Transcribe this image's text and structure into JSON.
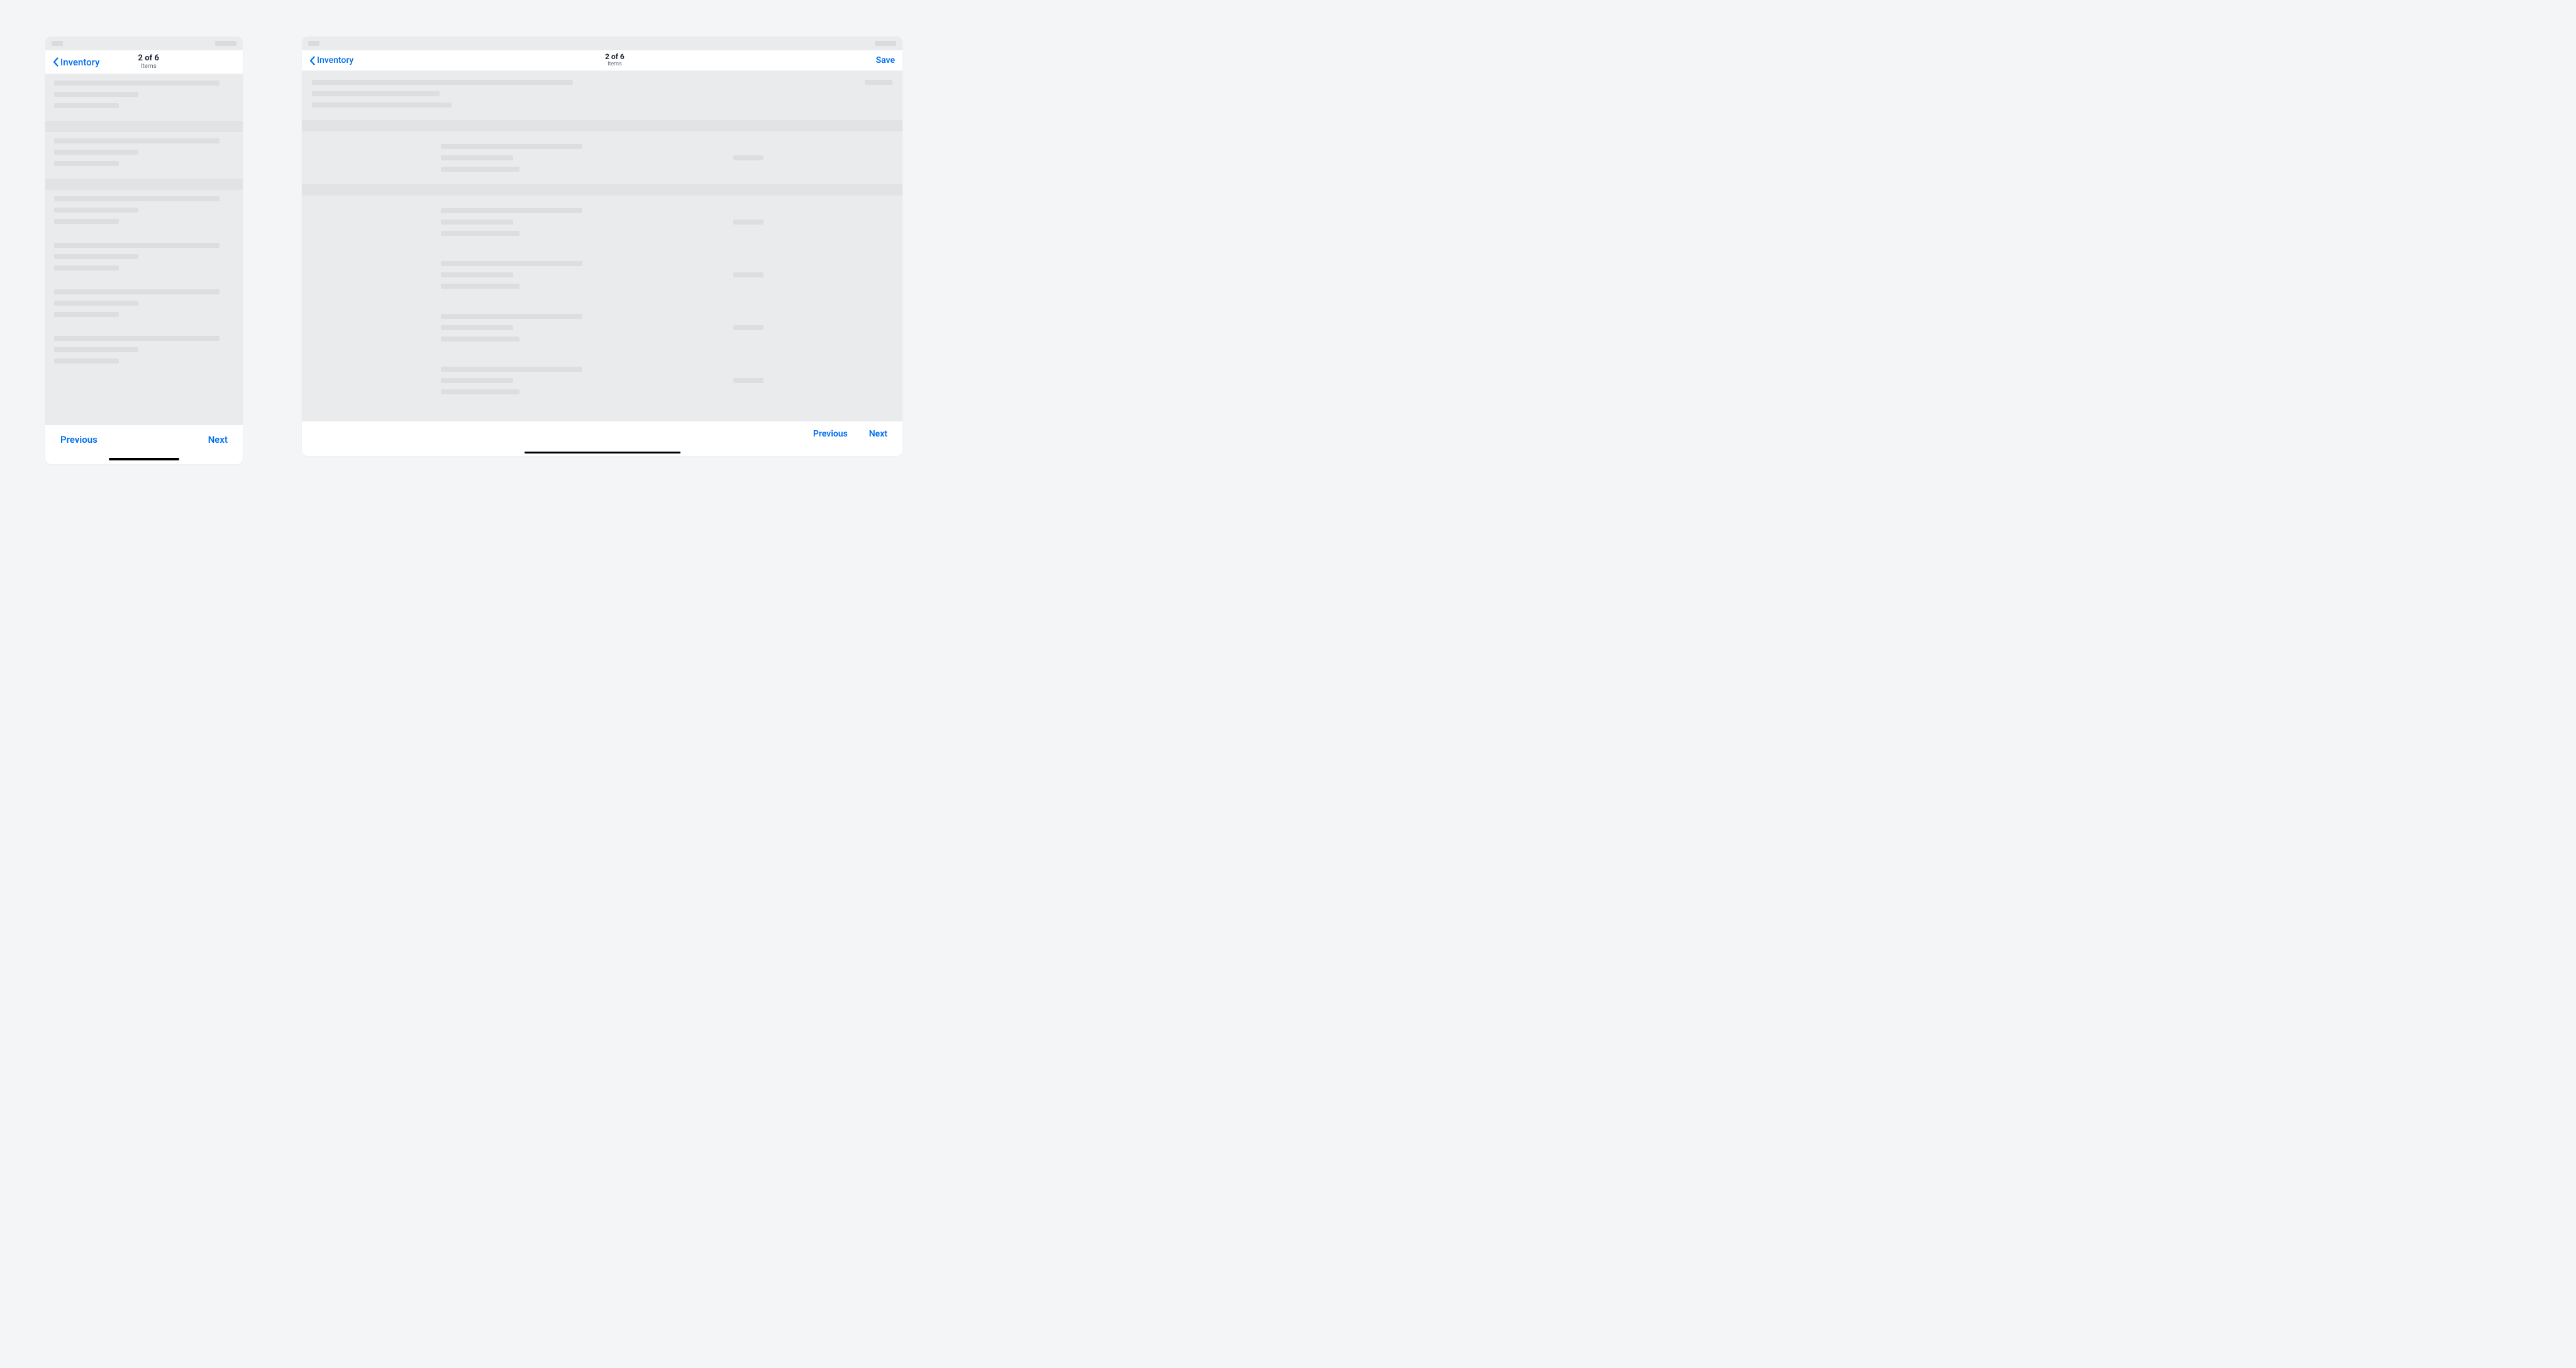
{
  "phone": {
    "nav": {
      "back_label": "Inventory",
      "title": "2 of 6",
      "subtitle": "Items"
    },
    "bottom": {
      "prev": "Previous",
      "next": "Next"
    }
  },
  "tablet": {
    "nav": {
      "back_label": "Inventory",
      "title": "2 of 6",
      "subtitle": "Items",
      "save": "Save"
    },
    "bottom": {
      "prev": "Previous",
      "next": "Next"
    }
  },
  "colors": {
    "accent": "#006fee"
  }
}
